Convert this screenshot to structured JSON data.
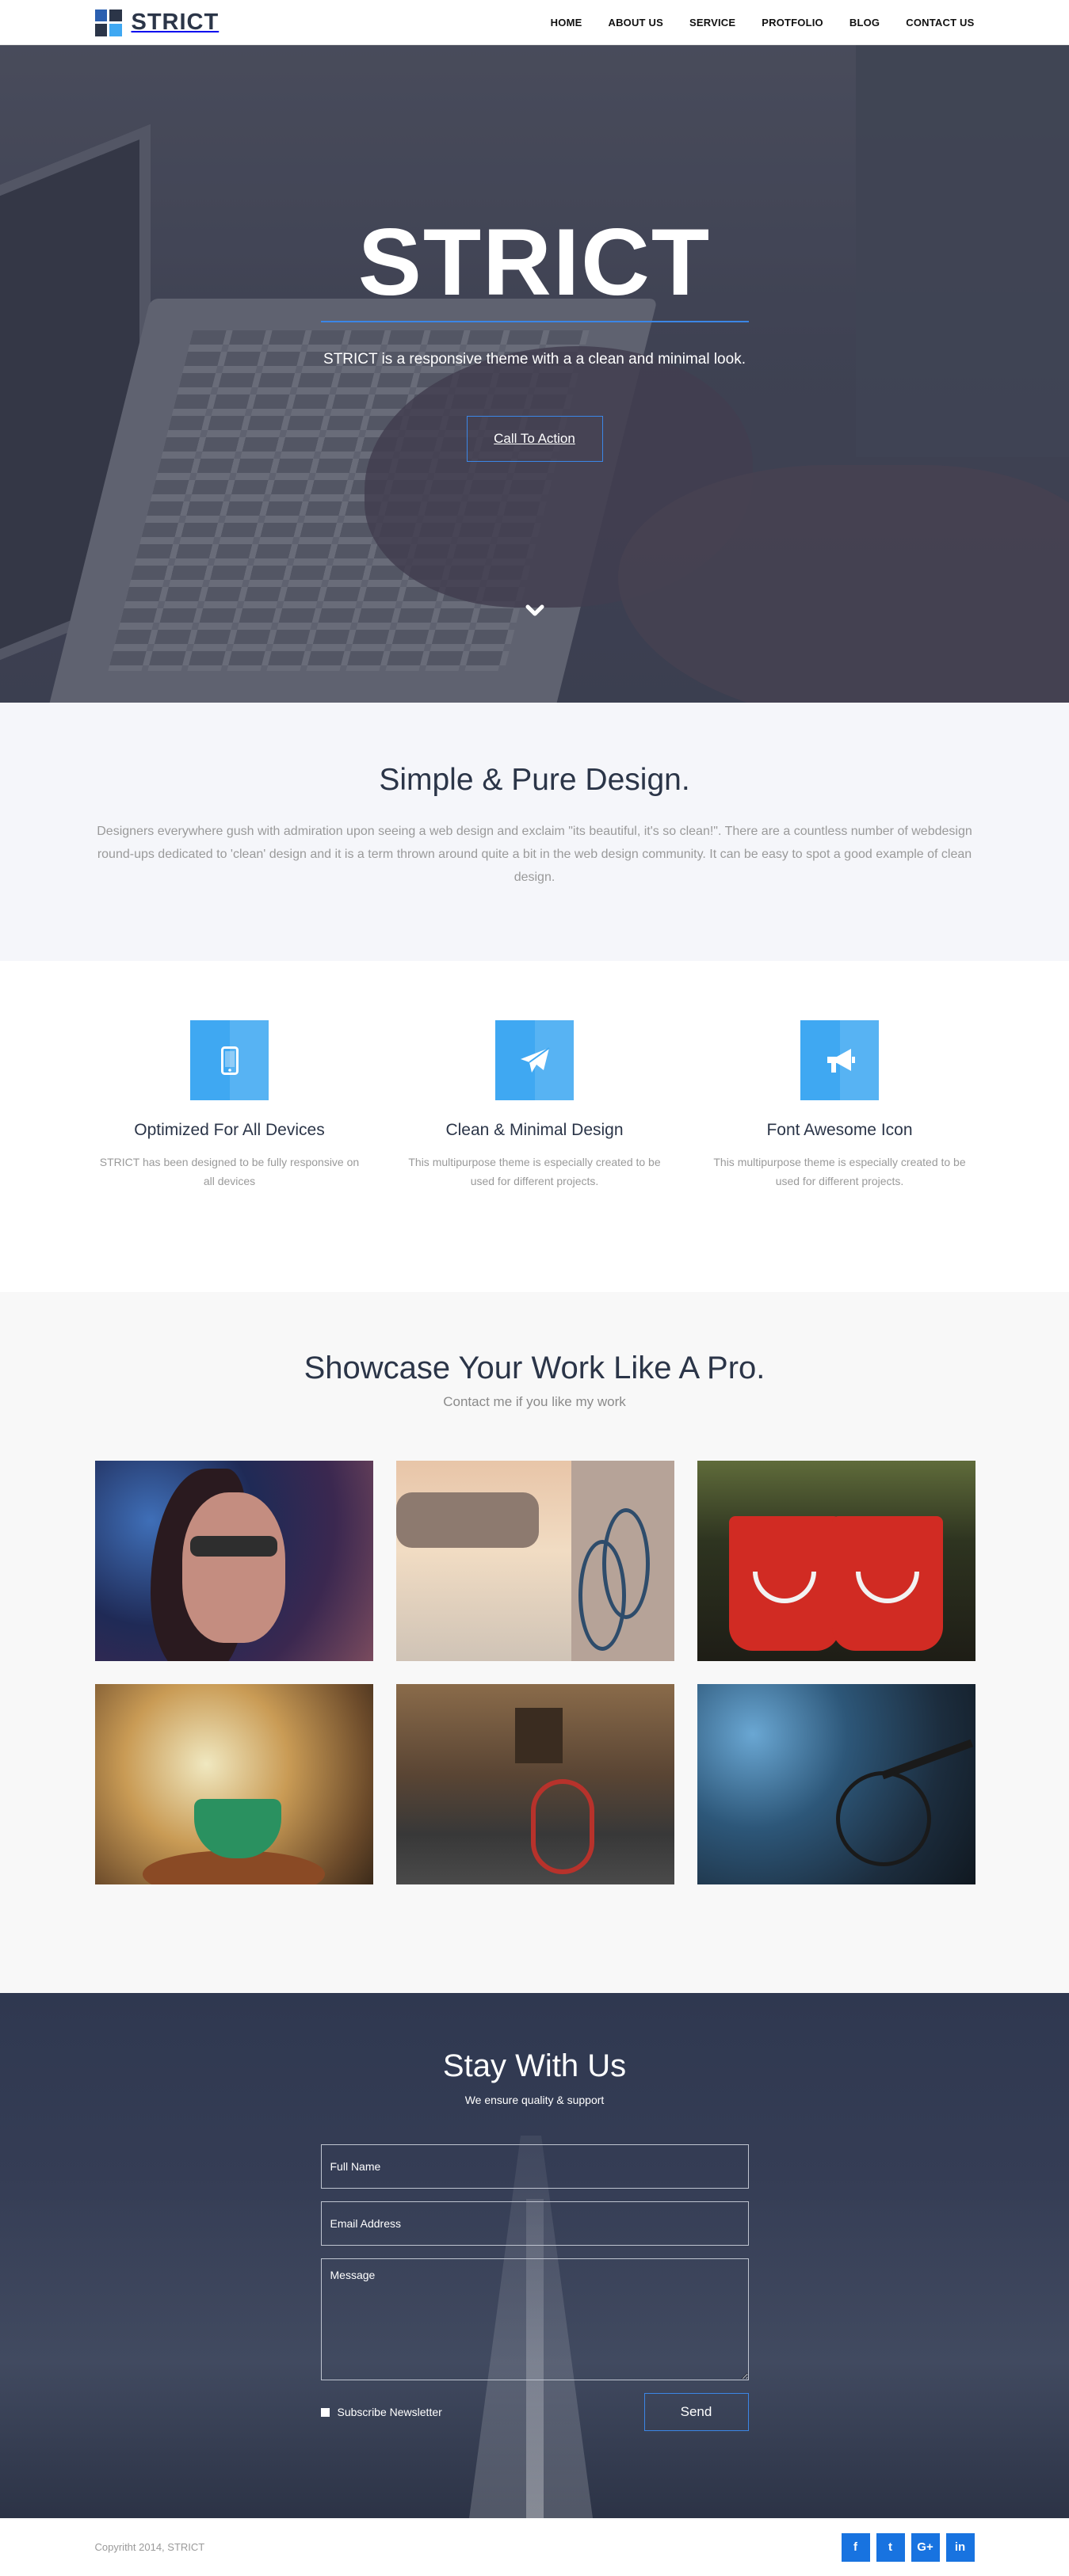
{
  "navbar": {
    "brand": "STRICT",
    "links": [
      "HOME",
      "ABOUT US",
      "SERVICE",
      "PROTFOLIO",
      "BLOG",
      "CONTACT US"
    ]
  },
  "hero": {
    "title": "STRICT",
    "subtitle": "STRICT is a responsive theme with a a clean and minimal look.",
    "cta_label": "Call To Action",
    "scroll_icon": "chevron-down-icon"
  },
  "intro": {
    "title": "Simple & Pure Design.",
    "body": "Designers everywhere gush with admiration upon seeing a web design and exclaim \"its beautiful, it's so clean!\". There are a countless number of webdesign round-ups dedicated to 'clean' design and it is a term thrown around quite a bit in the web design community. It can be easy to spot a good example of clean design."
  },
  "features": [
    {
      "icon": "mobile-icon",
      "title": "Optimized For All Devices",
      "text": "STRICT has been designed to be fully responsive on all devices"
    },
    {
      "icon": "paper-plane-icon",
      "title": "Clean & Minimal Design",
      "text": "This multipurpose theme is especially created to be used for different projects."
    },
    {
      "icon": "bullhorn-icon",
      "title": "Font Awesome Icon",
      "text": "This multipurpose theme is especially created to be used for different projects."
    }
  ],
  "portfolio": {
    "title": "Showcase Your Work Like A Pro.",
    "subtitle": "Contact me if you like my work"
  },
  "contact": {
    "title": "Stay With Us",
    "tagline": "We ensure quality & support",
    "name_placeholder": "Full Name",
    "email_placeholder": "Email Address",
    "message_placeholder": "Message",
    "subscribe_label": "Subscribe Newsletter",
    "send_label": "Send"
  },
  "footer": {
    "copyright": "Copyritht 2014, STRICT",
    "socials": [
      "f",
      "t",
      "G+",
      "in"
    ]
  },
  "colors": {
    "accent": "#3b86e6",
    "icon_tile": "#3fa8f2",
    "social": "#1873e0",
    "heading": "#2b3548"
  }
}
